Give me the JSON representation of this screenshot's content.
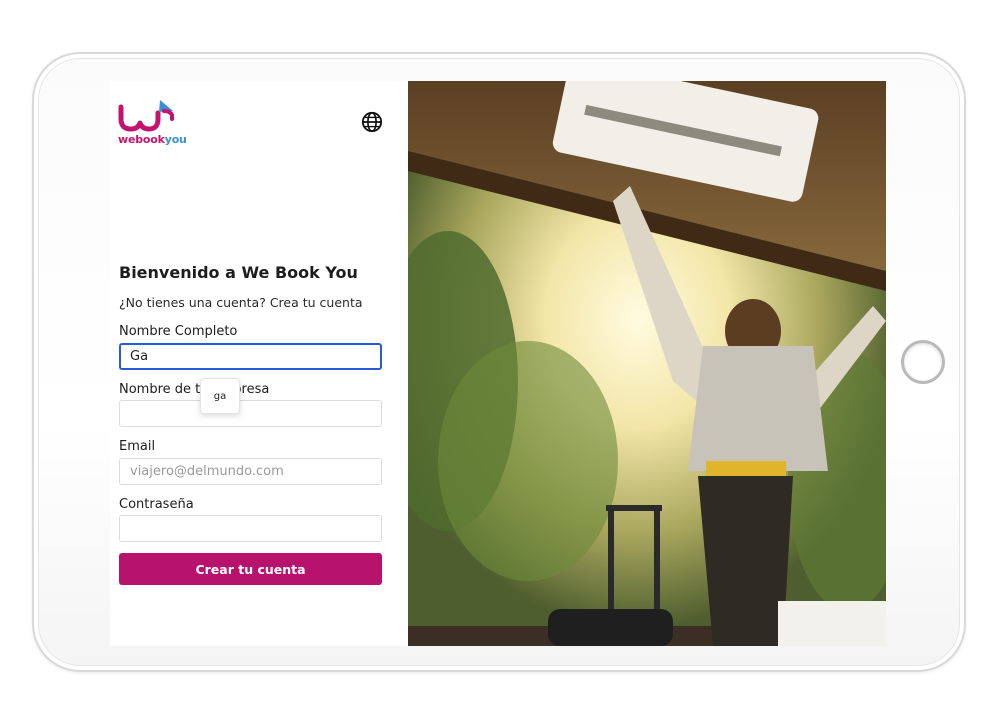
{
  "brand": {
    "logo_text_part1": "webook",
    "logo_text_part2": "you",
    "primary": "#b8136c",
    "secondary": "#3a8fd4"
  },
  "header": {
    "language_icon": "globe-icon"
  },
  "form": {
    "title": "Bienvenido a We Book You",
    "signin_prompt": "¿No tienes una cuenta? Crea tu cuenta",
    "full_name_label": "Nombre Completo",
    "full_name_value": "Ga",
    "company_label": "Nombre de tu empresa",
    "company_value": "",
    "email_label": "Email",
    "email_placeholder": "viajero@delmundo.com",
    "password_label": "Contraseña",
    "password_value": "",
    "autocomplete_suggestion": "ga",
    "submit_label": "Crear tu cuenta"
  }
}
